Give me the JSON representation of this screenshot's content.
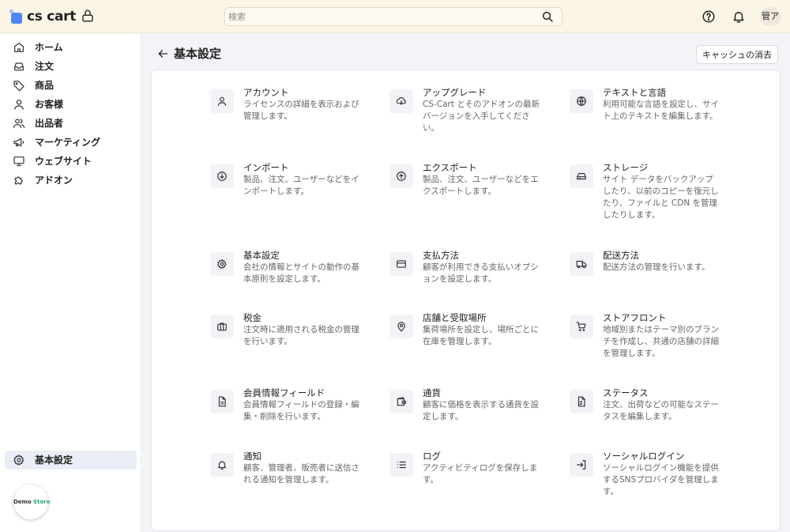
{
  "app": {
    "logo_text": "cs cart"
  },
  "search": {
    "placeholder": "検索"
  },
  "header": {
    "avatar": "管ア"
  },
  "sidebar": {
    "items": [
      {
        "label": "ホーム"
      },
      {
        "label": "注文"
      },
      {
        "label": "商品"
      },
      {
        "label": "お客様"
      },
      {
        "label": "出品者"
      },
      {
        "label": "マーケティング"
      },
      {
        "label": "ウェブサイト"
      },
      {
        "label": "アドオン"
      }
    ],
    "settings": "基本設定",
    "demo": {
      "a": "Demo",
      "b": "Store"
    }
  },
  "page": {
    "title": "基本設定",
    "clear_cache": "キャッシュの消去"
  },
  "tiles": [
    {
      "title": "アカウント",
      "desc": "ライセンスの詳細を表示および管理します。"
    },
    {
      "title": "アップグレード",
      "desc": "CS-Cart とそのアドオンの最新バージョンを入手してください。"
    },
    {
      "title": "テキストと言語",
      "desc": "利用可能な言語を設定し、サイト上のテキストを編集します。"
    },
    {
      "title": "インポート",
      "desc": "製品、注文、ユーザーなどをインポートします。"
    },
    {
      "title": "エクスポート",
      "desc": "製品、注文、ユーザーなどをエクスポートします。"
    },
    {
      "title": "ストレージ",
      "desc": "サイト データをバックアップしたり、以前のコピーを復元したり、ファイルと CDN を管理したりします。"
    },
    {
      "title": "基本設定",
      "desc": "会社の情報とサイトの動作の基本原則を設定します。"
    },
    {
      "title": "支払方法",
      "desc": "顧客が利用できる支払いオプションを設定します。"
    },
    {
      "title": "配送方法",
      "desc": "配送方法の管理を行います。"
    },
    {
      "title": "税金",
      "desc": "注文時に適用される税金の管理を行います。"
    },
    {
      "title": "店舗と受取場所",
      "desc": "集荷場所を設定し、場所ごとに在庫を管理します。"
    },
    {
      "title": "ストアフロント",
      "desc": "地域別またはテーマ別のブランチを作成し、共通の店舗の詳細を管理します。"
    },
    {
      "title": "会員情報フィールド",
      "desc": "会員情報フィールドの登録・編集・削除を行います。"
    },
    {
      "title": "通貨",
      "desc": "顧客に価格を表示する通貨を設定します。"
    },
    {
      "title": "ステータス",
      "desc": "注文、出荷などの可能なステータスを編集します。"
    },
    {
      "title": "通知",
      "desc": "顧客、管理者、販売者に送信される通知を管理します。"
    },
    {
      "title": "ログ",
      "desc": "アクティビティログを保存します。"
    },
    {
      "title": "ソーシャルログイン",
      "desc": "ソーシャルログイン機能を提供するSNSプロバイダを管理します。"
    }
  ]
}
